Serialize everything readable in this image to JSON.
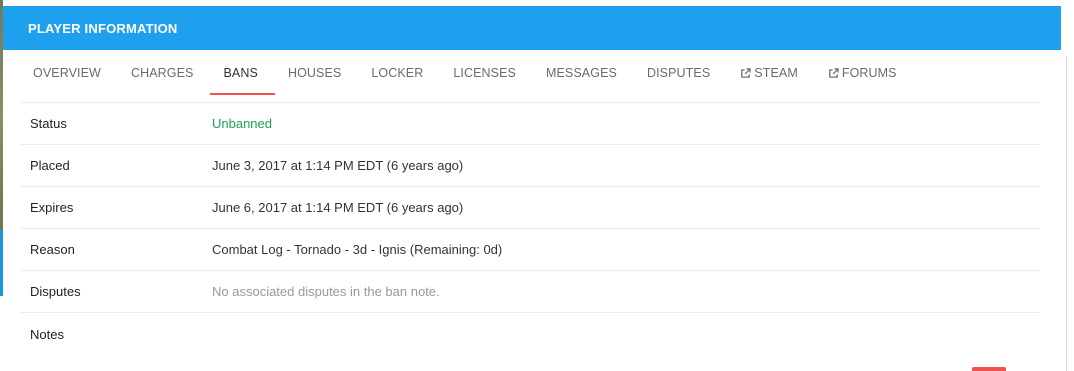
{
  "header": {
    "title": "PLAYER INFORMATION"
  },
  "tabs": [
    {
      "label": "OVERVIEW",
      "active": false,
      "external": false
    },
    {
      "label": "CHARGES",
      "active": false,
      "external": false
    },
    {
      "label": "BANS",
      "active": true,
      "external": false
    },
    {
      "label": "HOUSES",
      "active": false,
      "external": false
    },
    {
      "label": "LOCKER",
      "active": false,
      "external": false
    },
    {
      "label": "LICENSES",
      "active": false,
      "external": false
    },
    {
      "label": "MESSAGES",
      "active": false,
      "external": false
    },
    {
      "label": "DISPUTES",
      "active": false,
      "external": false
    },
    {
      "label": "STEAM",
      "active": false,
      "external": true
    },
    {
      "label": "FORUMS",
      "active": false,
      "external": true
    }
  ],
  "ban": {
    "rows": [
      {
        "label": "Status",
        "value": "Unbanned"
      },
      {
        "label": "Placed",
        "value": "June 3, 2017 at 1:14 PM EDT (6 years ago)"
      },
      {
        "label": "Expires",
        "value": "June 6, 2017 at 1:14 PM EDT (6 years ago)"
      },
      {
        "label": "Reason",
        "value": "Combat Log - Tornado - 3d - Ignis (Remaining: 0d)"
      },
      {
        "label": "Disputes",
        "value": "No associated disputes in the ban note."
      },
      {
        "label": "Notes",
        "value": ""
      }
    ]
  },
  "colors": {
    "header_bg": "#1fa0ef",
    "active_tab_underline": "#ef5350",
    "status_unbanned": "#1aa05a"
  },
  "icons": {
    "external_link": "external-link-icon"
  }
}
